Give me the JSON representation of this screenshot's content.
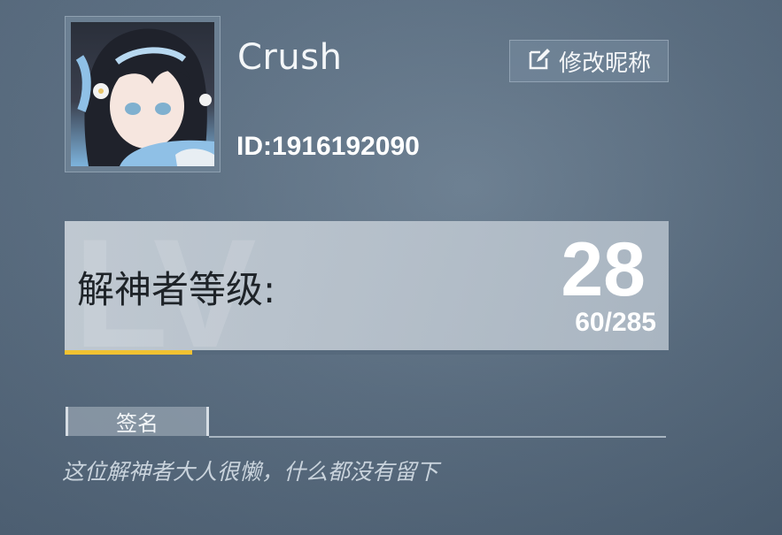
{
  "profile": {
    "nickname": "Crush",
    "user_id": "ID:1916192090",
    "edit_button_label": "修改昵称",
    "edit_icon": "edit-icon"
  },
  "level": {
    "watermark": "LV",
    "title": "解神者等级:",
    "value": "28",
    "exp_text": "60/285",
    "exp_fraction": 0.2105
  },
  "signature": {
    "tab_label": "签名",
    "text": "这位解神者大人很懒，什么都没有留下"
  },
  "colors": {
    "accent_progress": "#f1c232",
    "text_primary": "#ffffff"
  }
}
